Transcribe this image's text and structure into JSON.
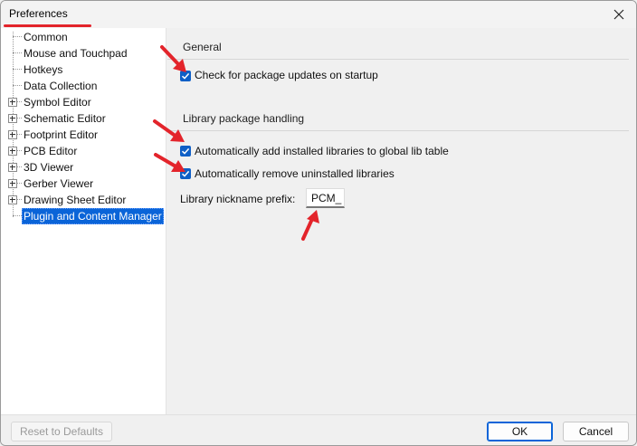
{
  "window": {
    "title": "Preferences",
    "close_icon": "close-icon",
    "accent": "#e3242b"
  },
  "sidebar": {
    "items": [
      {
        "label": "Common",
        "expandable": false
      },
      {
        "label": "Mouse and Touchpad",
        "expandable": false
      },
      {
        "label": "Hotkeys",
        "expandable": false
      },
      {
        "label": "Data Collection",
        "expandable": false
      },
      {
        "label": "Symbol Editor",
        "expandable": true
      },
      {
        "label": "Schematic Editor",
        "expandable": true
      },
      {
        "label": "Footprint Editor",
        "expandable": true
      },
      {
        "label": "PCB Editor",
        "expandable": true
      },
      {
        "label": "3D Viewer",
        "expandable": true
      },
      {
        "label": "Gerber Viewer",
        "expandable": true
      },
      {
        "label": "Drawing Sheet Editor",
        "expandable": true
      },
      {
        "label": "Plugin and Content Manager",
        "expandable": false,
        "selected": true
      }
    ]
  },
  "main": {
    "general": {
      "title": "General",
      "check_updates": {
        "label": "Check for package updates on startup",
        "checked": true
      }
    },
    "library": {
      "title": "Library package handling",
      "auto_add": {
        "label": "Automatically add installed libraries to global lib table",
        "checked": true
      },
      "auto_remove": {
        "label": "Automatically remove uninstalled libraries",
        "checked": true
      },
      "prefix_label": "Library nickname prefix:",
      "prefix_value": "PCM_"
    }
  },
  "footer": {
    "reset_label": "Reset to Defaults",
    "ok_label": "OK",
    "cancel_label": "Cancel"
  },
  "colors": {
    "selection": "#0a64d8",
    "checkbox": "#0f5fc6",
    "annotation_arrow": "#e3242b"
  }
}
